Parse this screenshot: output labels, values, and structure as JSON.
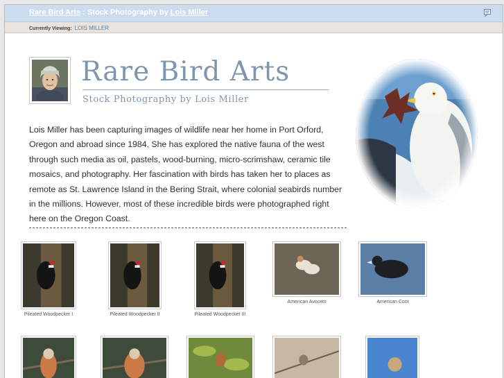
{
  "header": {
    "site_link": "Rare Bird Arts",
    "separator": ":",
    "title_text": "Stock Photography by",
    "owner_link": "Lois Miller"
  },
  "subheader": {
    "label": "Currently Viewing:",
    "value": "LOIS MILLER"
  },
  "logo": {
    "title": "Rare Bird Arts",
    "subtitle": "Stock Photography by Lois Miller"
  },
  "bio": "Lois Miller has been capturing images of wildlife near her home in Port Orford, Oregon and abroad since 1984. She has explored the native fauna of the west through such media as oil, pastels, wood-burning, micro-scrimshaw, ceramic tile mosaics, and photography. Her fascination with birds has taken her to places as remote as St. Lawrence Island in the Bering Strait, where colonial seabirds number in the millions. However, most of these incredible birds were photographed right here on the Oregon Coast.",
  "gallery": [
    {
      "caption": "Pileated Woodpecker I"
    },
    {
      "caption": "Pileated Woodpecker II"
    },
    {
      "caption": "Pileated Woodpecker III"
    },
    {
      "caption": "American Avocets"
    },
    {
      "caption": "American Coot"
    },
    {
      "caption": ""
    },
    {
      "caption": ""
    },
    {
      "caption": ""
    },
    {
      "caption": ""
    },
    {
      "caption": ""
    }
  ],
  "colors": {
    "topbar": "#cbdcef",
    "subbar": "#e8e3df",
    "logo_text": "#7e95ad",
    "link": "#ffffff"
  }
}
